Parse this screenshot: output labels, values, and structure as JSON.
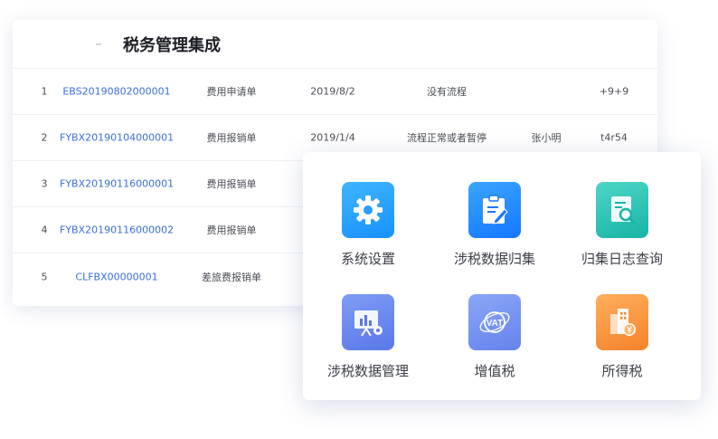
{
  "page_title": "税务管理集成",
  "table": {
    "rows": [
      {
        "index": "1",
        "code": "EBS20190802000001",
        "type": "费用申请单",
        "date": "2019/8/2",
        "status": "没有流程",
        "user": "",
        "extra": "+9+9"
      },
      {
        "index": "2",
        "code": "FYBX20190104000001",
        "type": "费用报销单",
        "date": "2019/1/4",
        "status": "流程正常或者暂停",
        "user": "张小明",
        "extra": "t4r54"
      },
      {
        "index": "3",
        "code": "FYBX20190116000001",
        "type": "费用报销单",
        "date": "",
        "status": "",
        "user": "",
        "extra": ""
      },
      {
        "index": "4",
        "code": "FYBX20190116000002",
        "type": "费用报销单",
        "date": "",
        "status": "",
        "user": "",
        "extra": ""
      },
      {
        "index": "5",
        "code": "CLFBX00000001",
        "type": "差旅费报销单",
        "date": "",
        "status": "",
        "user": "",
        "extra": ""
      }
    ]
  },
  "tiles": [
    {
      "label": "系统设置",
      "icon": "gear-icon",
      "color": "#1890ff"
    },
    {
      "label": "涉税数据归集",
      "icon": "clipboard-edit-icon",
      "color": "#1677ff"
    },
    {
      "label": "归集日志查询",
      "icon": "document-search-icon",
      "color": "#17b4a6"
    },
    {
      "label": "涉税数据管理",
      "icon": "chart-presentation-icon",
      "color": "#5a78e8"
    },
    {
      "label": "增值税",
      "icon": "vat-icon",
      "color": "#6683ec"
    },
    {
      "label": "所得税",
      "icon": "building-yen-icon",
      "color": "#f5832b"
    }
  ]
}
